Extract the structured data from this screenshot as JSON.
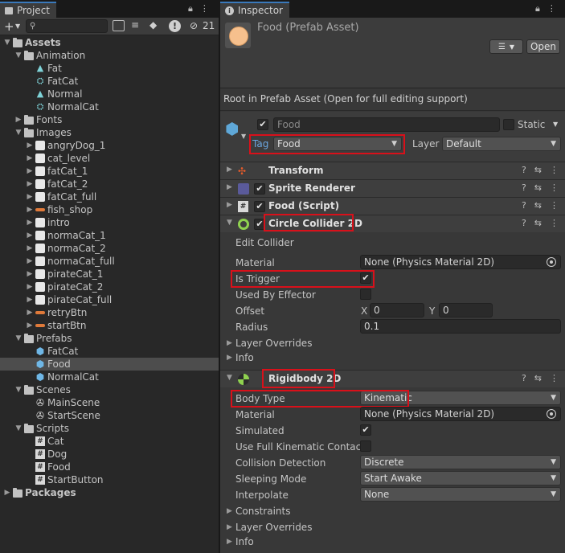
{
  "project": {
    "tab_label": "Project",
    "search_placeholder": "",
    "hidden_count": "21",
    "tree": [
      {
        "label": "Assets",
        "depth": 0,
        "arrow": "▼",
        "icon": "folder",
        "bold": true
      },
      {
        "label": "Animation",
        "depth": 1,
        "arrow": "▼",
        "icon": "folder"
      },
      {
        "label": "Fat",
        "depth": 2,
        "arrow": "",
        "icon": "anim"
      },
      {
        "label": "FatCat",
        "depth": 2,
        "arrow": "",
        "icon": "animator"
      },
      {
        "label": "Normal",
        "depth": 2,
        "arrow": "",
        "icon": "anim"
      },
      {
        "label": "NormalCat",
        "depth": 2,
        "arrow": "",
        "icon": "animator"
      },
      {
        "label": "Fonts",
        "depth": 1,
        "arrow": "▶",
        "icon": "folder"
      },
      {
        "label": "Images",
        "depth": 1,
        "arrow": "▼",
        "icon": "folder"
      },
      {
        "label": "angryDog_1",
        "depth": 2,
        "arrow": "▶",
        "icon": "sprite"
      },
      {
        "label": "cat_level",
        "depth": 2,
        "arrow": "▶",
        "icon": "sprite"
      },
      {
        "label": "fatCat_1",
        "depth": 2,
        "arrow": "▶",
        "icon": "sprite"
      },
      {
        "label": "fatCat_2",
        "depth": 2,
        "arrow": "▶",
        "icon": "sprite"
      },
      {
        "label": "fatCat_full",
        "depth": 2,
        "arrow": "▶",
        "icon": "sprite"
      },
      {
        "label": "fish_shop",
        "depth": 2,
        "arrow": "▶",
        "icon": "sprite-bar"
      },
      {
        "label": "intro",
        "depth": 2,
        "arrow": "▶",
        "icon": "sprite"
      },
      {
        "label": "normaCat_1",
        "depth": 2,
        "arrow": "▶",
        "icon": "sprite"
      },
      {
        "label": "normaCat_2",
        "depth": 2,
        "arrow": "▶",
        "icon": "sprite"
      },
      {
        "label": "normaCat_full",
        "depth": 2,
        "arrow": "▶",
        "icon": "sprite"
      },
      {
        "label": "pirateCat_1",
        "depth": 2,
        "arrow": "▶",
        "icon": "sprite"
      },
      {
        "label": "pirateCat_2",
        "depth": 2,
        "arrow": "▶",
        "icon": "sprite"
      },
      {
        "label": "pirateCat_full",
        "depth": 2,
        "arrow": "▶",
        "icon": "sprite"
      },
      {
        "label": "retryBtn",
        "depth": 2,
        "arrow": "▶",
        "icon": "sprite-bar"
      },
      {
        "label": "startBtn",
        "depth": 2,
        "arrow": "▶",
        "icon": "sprite-bar"
      },
      {
        "label": "Prefabs",
        "depth": 1,
        "arrow": "▼",
        "icon": "folder"
      },
      {
        "label": "FatCat",
        "depth": 2,
        "arrow": "",
        "icon": "prefab"
      },
      {
        "label": "Food",
        "depth": 2,
        "arrow": "",
        "icon": "prefab",
        "selected": true
      },
      {
        "label": "NormalCat",
        "depth": 2,
        "arrow": "",
        "icon": "prefab"
      },
      {
        "label": "Scenes",
        "depth": 1,
        "arrow": "▼",
        "icon": "folder"
      },
      {
        "label": "MainScene",
        "depth": 2,
        "arrow": "",
        "icon": "scene"
      },
      {
        "label": "StartScene",
        "depth": 2,
        "arrow": "",
        "icon": "scene"
      },
      {
        "label": "Scripts",
        "depth": 1,
        "arrow": "▼",
        "icon": "folder"
      },
      {
        "label": "Cat",
        "depth": 2,
        "arrow": "",
        "icon": "script"
      },
      {
        "label": "Dog",
        "depth": 2,
        "arrow": "",
        "icon": "script"
      },
      {
        "label": "Food",
        "depth": 2,
        "arrow": "",
        "icon": "script"
      },
      {
        "label": "StartButton",
        "depth": 2,
        "arrow": "",
        "icon": "script"
      },
      {
        "label": "Packages",
        "depth": 0,
        "arrow": "▶",
        "icon": "folder",
        "bold": true
      }
    ]
  },
  "inspector": {
    "tab_label": "Inspector",
    "asset_title": "Food (Prefab Asset)",
    "open_button": "Open",
    "note": "Root in Prefab Asset (Open for full editing support)",
    "object_name": "Food",
    "static_label": "Static",
    "tag_label": "Tag",
    "tag_value": "Food",
    "layer_label": "Layer",
    "layer_value": "Default",
    "components": {
      "transform": "Transform",
      "sprite_renderer": "Sprite Renderer",
      "food_script": "Food (Script)",
      "circle_collider": "Circle Collider 2D",
      "rigidbody": "Rigidbody 2D"
    },
    "collider": {
      "edit_collider": "Edit Collider",
      "material_label": "Material",
      "material_value": "None (Physics Material 2D)",
      "is_trigger_label": "Is Trigger",
      "used_by_effector_label": "Used By Effector",
      "offset_label": "Offset",
      "offset_x_label": "X",
      "offset_x": "0",
      "offset_y_label": "Y",
      "offset_y": "0",
      "radius_label": "Radius",
      "radius": "0.1",
      "layer_overrides": "Layer Overrides",
      "info": "Info"
    },
    "rigidbody": {
      "body_type_label": "Body Type",
      "body_type": "Kinematic",
      "material_label": "Material",
      "material_value": "None (Physics Material 2D)",
      "simulated_label": "Simulated",
      "full_kinematic_label": "Use Full Kinematic Contact",
      "collision_label": "Collision Detection",
      "collision_value": "Discrete",
      "sleeping_label": "Sleeping Mode",
      "sleeping_value": "Start Awake",
      "interpolate_label": "Interpolate",
      "interpolate_value": "None",
      "constraints": "Constraints",
      "layer_overrides": "Layer Overrides",
      "info": "Info"
    }
  },
  "colors": {
    "highlight_box": "#d9101a",
    "tab_accent": "#3a79bb",
    "selected_row": "#4d4d4d"
  }
}
